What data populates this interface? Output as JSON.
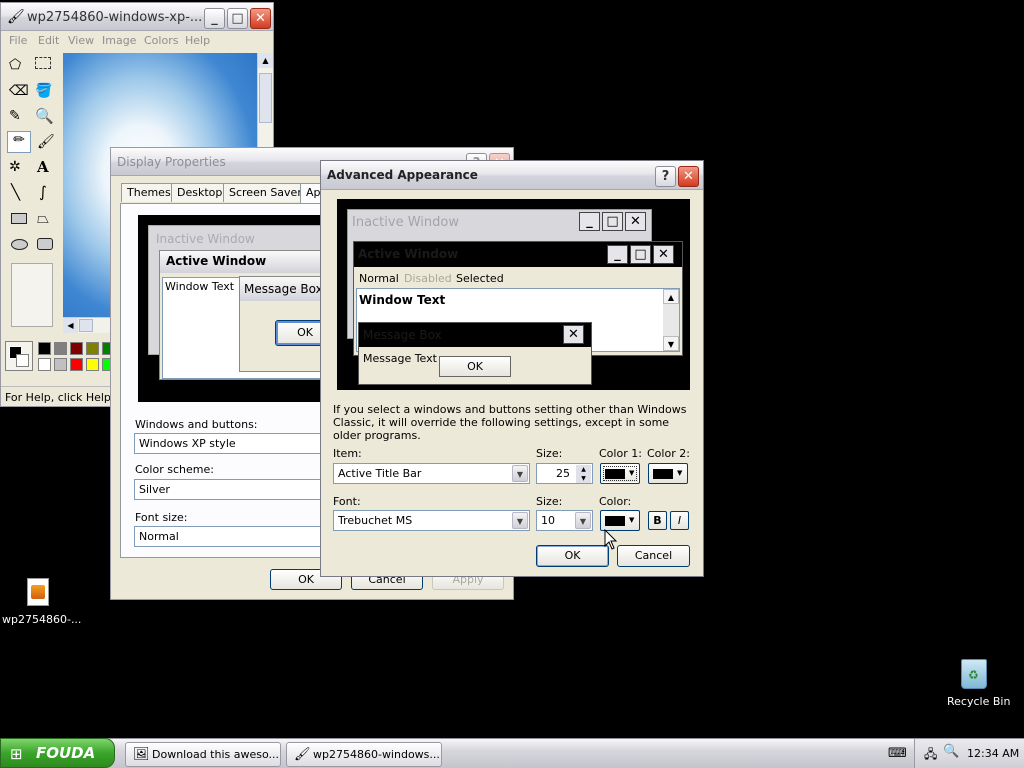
{
  "paint": {
    "title": "wp2754860-windows-xp-...",
    "menu": [
      "File",
      "Edit",
      "View",
      "Image",
      "Colors",
      "Help"
    ],
    "status": "For Help, click Help To"
  },
  "display_properties": {
    "title": "Display Properties",
    "tabs": [
      "Themes",
      "Desktop",
      "Screen Saver",
      "Ap"
    ],
    "preview": {
      "inactive_title": "Inactive Window",
      "active_title": "Active Window",
      "window_text": "Window Text",
      "message_box_title": "Message Box",
      "ok": "OK"
    },
    "windows_buttons_label": "Windows and buttons:",
    "windows_buttons_value": "Windows XP style",
    "color_scheme_label": "Color scheme:",
    "color_scheme_value": "Silver",
    "font_size_label": "Font size:",
    "font_size_value": "Normal",
    "ok": "OK",
    "cancel": "Cancel",
    "apply": "Apply"
  },
  "advanced": {
    "title": "Advanced Appearance",
    "preview": {
      "inactive_title": "Inactive Window",
      "active_title": "Active Window",
      "menu_normal": "Normal",
      "menu_disabled": "Disabled",
      "menu_selected": "Selected",
      "window_text": "Window Text",
      "message_box_title": "Message Box",
      "message_text": "Message Text",
      "ok": "OK"
    },
    "info_text": "If you select a windows and buttons setting other than Windows Classic, it will override the following settings, except in some older programs.",
    "item_label": "Item:",
    "item_value": "Active Title Bar",
    "size_label": "Size:",
    "item_size": "25",
    "color1_label": "Color 1:",
    "color2_label": "Color 2:",
    "font_label": "Font:",
    "font_value": "Trebuchet MS",
    "font_size_label": "Size:",
    "font_size_value": "10",
    "color_label": "Color:",
    "bold_label": "B",
    "italic_label": "I",
    "ok": "OK",
    "cancel": "Cancel"
  },
  "desktop": {
    "file_icon_label": "wp2754860-...",
    "recycle_label": "Recycle Bin"
  },
  "taskbar": {
    "start_label": "FOUDA",
    "task1": "Download this aweso...",
    "task2": "wp2754860-windows...",
    "clock": "12:34 AM"
  },
  "colors": {
    "title_active": "#000000",
    "palette": [
      "#000000",
      "#808080",
      "#800000",
      "#808000",
      "#008000",
      "#ffffff",
      "#c0c0c0",
      "#ff0000",
      "#ffff00",
      "#00ff00"
    ]
  }
}
